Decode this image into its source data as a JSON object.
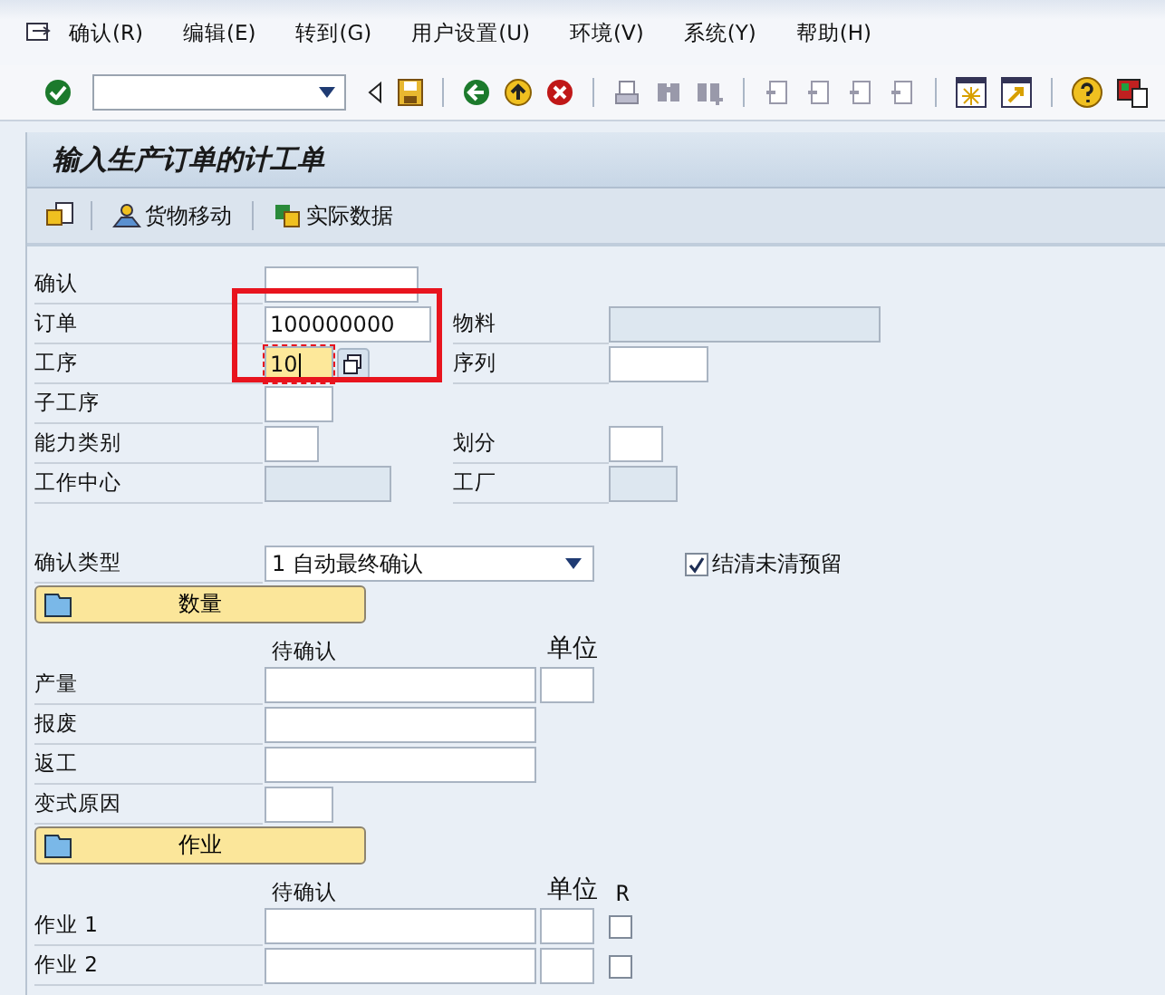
{
  "menu": [
    {
      "label": "确认(R)"
    },
    {
      "label": "编辑(E)"
    },
    {
      "label": "转到(G)"
    },
    {
      "label": "用户设置(U)"
    },
    {
      "label": "环境(V)"
    },
    {
      "label": "系统(Y)"
    },
    {
      "label": "帮助(H)"
    }
  ],
  "title": "输入生产订单的计工单",
  "app_toolbar": [
    {
      "kind": "icon"
    },
    {
      "kind": "goods",
      "label": "货物移动"
    },
    {
      "kind": "actual",
      "label": "实际数据"
    }
  ],
  "header_fields": [
    {
      "label": "确认",
      "kind": "input",
      "focused": false
    },
    {
      "label": "订单",
      "value": "100000000",
      "kind": "input",
      "focused": false,
      "right": {
        "label": "物料",
        "kind": "disabled"
      }
    },
    {
      "label": "工序",
      "value": "10",
      "kind": "input",
      "focused": true,
      "lookup": true,
      "right": {
        "label": "序列",
        "kind": "input"
      }
    },
    {
      "label": "子工序",
      "kind": "input",
      "focused": false
    },
    {
      "label": "能力类别",
      "kind": "input",
      "focused": false,
      "right": {
        "label": "划分",
        "kind": "input"
      }
    },
    {
      "label": "工作中心",
      "kind": "disabled",
      "focused": false,
      "right": {
        "label": "工厂",
        "kind": "disabled"
      }
    }
  ],
  "confirmation_type": {
    "label": "确认类型",
    "value": "1 自动最终确认"
  },
  "clear_reservations": {
    "label": "结清未清预留",
    "checked": true
  },
  "quantity_section": {
    "title": "数量",
    "columns": [
      "待确认",
      "单位"
    ],
    "rows": [
      {
        "label": "产量",
        "kind": "qty_unit"
      },
      {
        "label": "报废",
        "kind": "qty"
      },
      {
        "label": "返工",
        "kind": "qty"
      },
      {
        "label": "变式原因",
        "kind": "short"
      }
    ]
  },
  "activity_section": {
    "title": "作业",
    "columns": [
      "待确认",
      "单位",
      "R"
    ],
    "rows": [
      {
        "label": "作业 1",
        "checked": false
      },
      {
        "label": "作业 2",
        "checked": false
      }
    ]
  }
}
